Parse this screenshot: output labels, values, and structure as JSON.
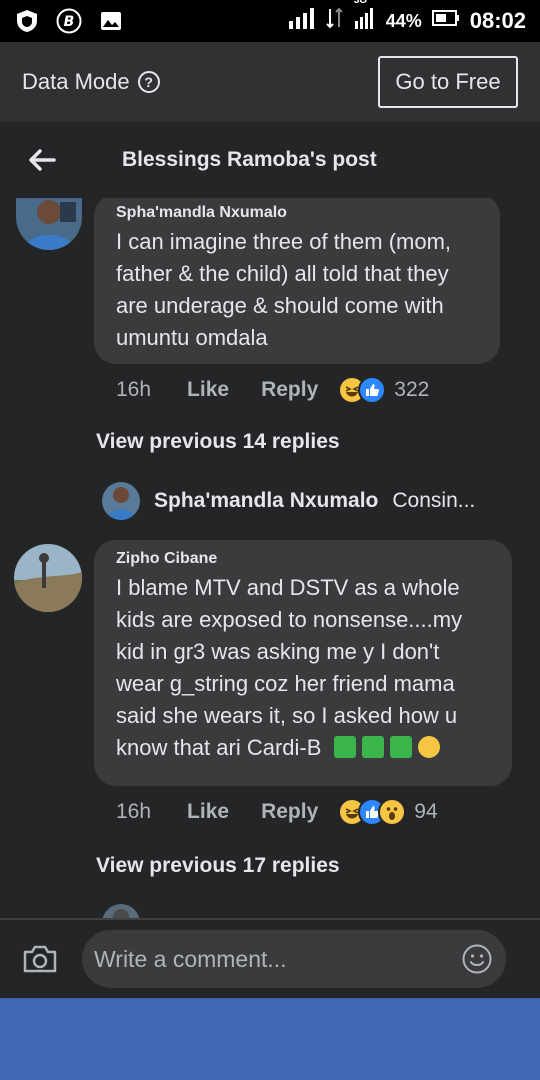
{
  "status_bar": {
    "network_type": "3G",
    "battery_percent": "44%",
    "time": "08:02",
    "icons": [
      "shield-icon",
      "b-app-icon",
      "image-icon",
      "signal-icon",
      "battery-icon"
    ]
  },
  "data_bar": {
    "label": "Data Mode",
    "help_icon": "?",
    "go_free_label": "Go to Free"
  },
  "header": {
    "title": "Blessings Ramoba's post"
  },
  "comments": [
    {
      "name": "Spha'mandla Nxumalo",
      "text": "I can imagine three of them (mom, father & the child) all told that they are underage & should come with umuntu omdala",
      "time": "16h",
      "like_label": "Like",
      "reply_label": "Reply",
      "reaction_count": "322",
      "view_previous": "View previous 14 replies",
      "reply_preview": {
        "name": "Spha'mandla Nxumalo",
        "text": "Consin..."
      }
    },
    {
      "name": "Zipho Cibane",
      "text": "I blame MTV and DSTV as a whole kids are exposed to nonsense....my kid in gr3 was asking me y I don't wear g_string coz her friend mama said she wears it, so I asked how u know that ari Cardi-B",
      "time": "16h",
      "like_label": "Like",
      "reply_label": "Reply",
      "reaction_count": "94",
      "view_previous": "View previous 17 replies"
    }
  ],
  "composer": {
    "placeholder": "Write a comment..."
  },
  "colors": {
    "background": "#242526",
    "bubble": "#3a3b3c",
    "like_blue": "#2d88ff",
    "haha_yellow": "#f7c544",
    "bottom_bar": "#4267b2"
  }
}
